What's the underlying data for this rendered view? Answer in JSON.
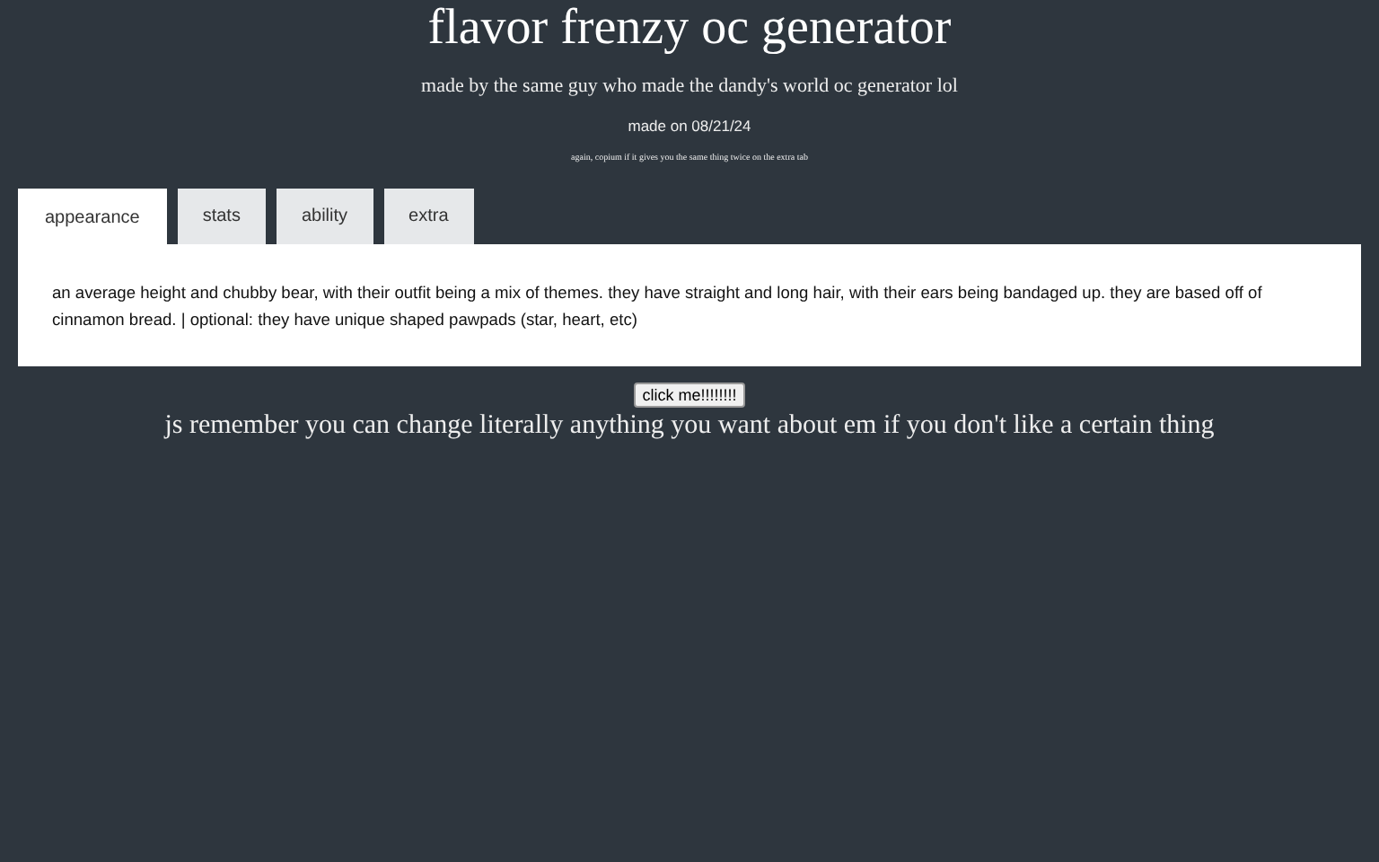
{
  "title": "flavor frenzy oc generator",
  "subtitle": "made by the same guy who made the dandy's world oc generator lol",
  "made_on": "made on 08/21/24",
  "note": "again, copium if it gives you the same thing twice on the extra tab",
  "tabs": [
    {
      "label": "appearance",
      "selected": true
    },
    {
      "label": "stats",
      "selected": false
    },
    {
      "label": "ability",
      "selected": false
    },
    {
      "label": "extra",
      "selected": false
    }
  ],
  "panel_text": "an average height and chubby bear, with their outfit being a mix of themes. they have straight and long hair, with their ears being bandaged up. they are based off of cinnamon bread. | optional: they have unique shaped pawpads (star, heart, etc)",
  "button": "click me!!!!!!!!",
  "footer": "js remember you can change literally anything you want about em if you don't like a certain thing"
}
